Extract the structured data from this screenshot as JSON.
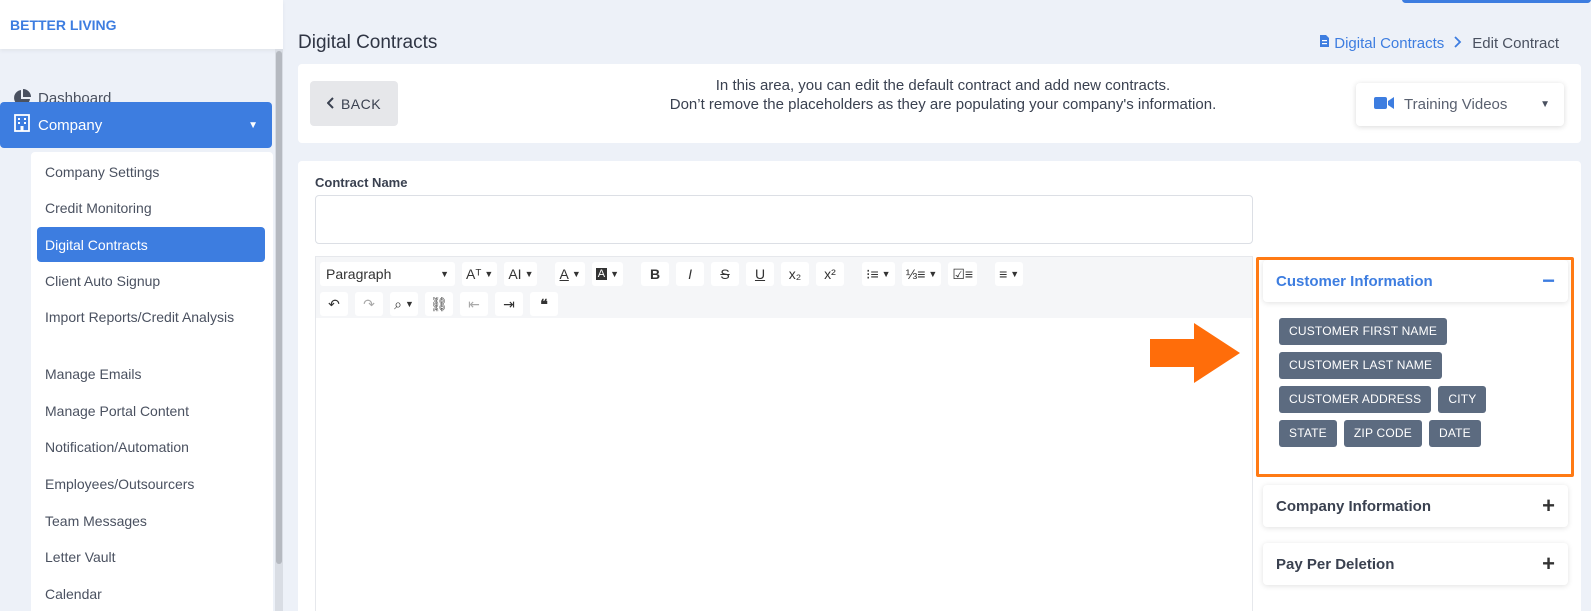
{
  "brand": "BETTER LIVING",
  "sidebar": {
    "dashboard": "Dashboard",
    "company": "Company",
    "submenu": [
      "Company Settings",
      "Credit Monitoring",
      "Digital Contracts",
      "Client Auto Signup",
      "Import Reports/Credit Analysis",
      "Manage Emails",
      "Manage Portal Content",
      "Notification/Automation",
      "Employees/Outsourcers",
      "Team Messages",
      "Letter Vault",
      "Calendar"
    ],
    "active_item": "Digital Contracts"
  },
  "header": {
    "title": "Digital Contracts",
    "breadcrumb_link": "Digital Contracts",
    "breadcrumb_current": "Edit Contract"
  },
  "info": {
    "back_label": "BACK",
    "line1": "In this area, you can edit the default contract and add new contracts.",
    "line2": "Don’t remove the placeholders as they are populating your company's information.",
    "training_label": "Training Videos"
  },
  "form": {
    "contract_name_label": "Contract Name",
    "contract_name_value": ""
  },
  "editor": {
    "paragraph_label": "Paragraph"
  },
  "panels": {
    "customer": {
      "title": "Customer Information",
      "toggle": "−",
      "tags": [
        [
          "CUSTOMER FIRST NAME"
        ],
        [
          "CUSTOMER LAST NAME"
        ],
        [
          "CUSTOMER ADDRESS",
          "CITY"
        ],
        [
          "STATE",
          "ZIP CODE",
          "DATE"
        ]
      ]
    },
    "company": {
      "title": "Company Information",
      "toggle": "+"
    },
    "pay": {
      "title": "Pay Per Deletion",
      "toggle": "+"
    }
  },
  "colors": {
    "accent": "#3d7de0",
    "highlight": "#ff7a14",
    "tag": "#5c6b80"
  }
}
